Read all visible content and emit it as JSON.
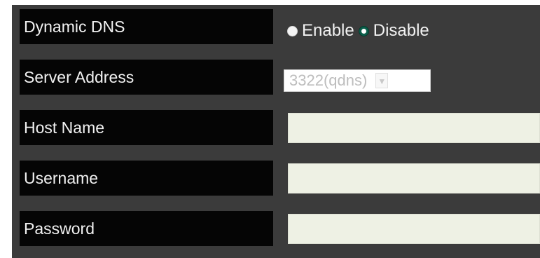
{
  "form": {
    "dynamic_dns": {
      "label": "Dynamic DNS",
      "options": [
        {
          "label": "Enable",
          "checked": false
        },
        {
          "label": "Disable",
          "checked": true
        }
      ]
    },
    "server_address": {
      "label": "Server Address",
      "selected_value": "3322(qdns)",
      "disabled": true
    },
    "host_name": {
      "label": "Host Name",
      "value": "",
      "placeholder": ""
    },
    "username": {
      "label": "Username",
      "value": "",
      "placeholder": ""
    },
    "password": {
      "label": "Password",
      "value": "",
      "placeholder": ""
    }
  },
  "icons": {
    "radio_unchecked": "radio-unchecked-icon",
    "radio_checked": "radio-checked-icon",
    "dropdown_arrow": "chevron-down-icon"
  },
  "colors": {
    "panel_background": "#3b3b3b",
    "label_background": "#050505",
    "label_text": "#f2f2f2",
    "input_background": "#eef1e4",
    "radio_checked": "#0a5e4a",
    "disabled_text": "#bdbdbd"
  }
}
